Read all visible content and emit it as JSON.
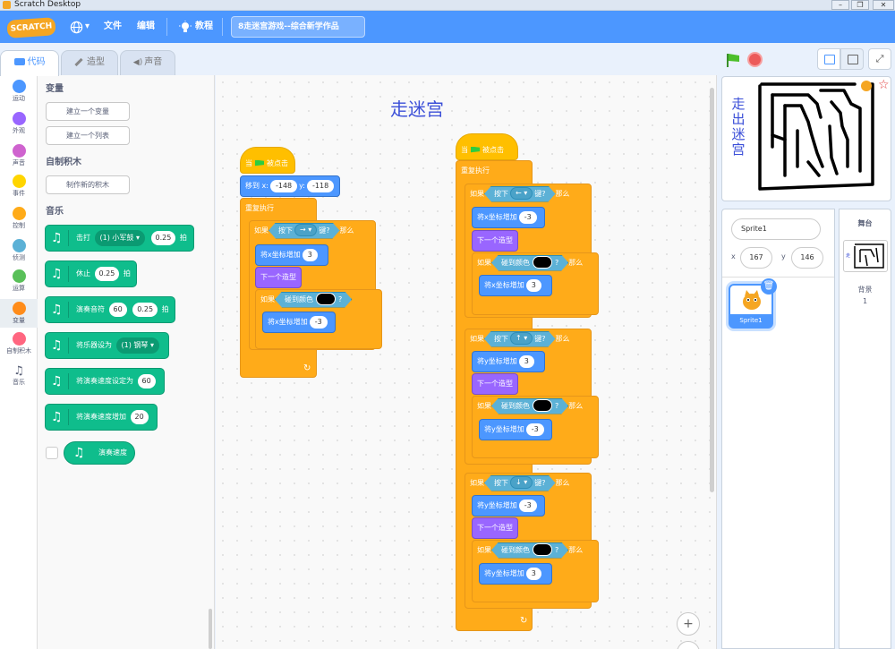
{
  "window": {
    "title": "Scratch Desktop",
    "buttons": [
      "–",
      "❐",
      "✕"
    ]
  },
  "menubar": {
    "logo": "SCRATCH",
    "globe_caret": "▾",
    "file": "文件",
    "edit": "编辑",
    "tutorials": "教程",
    "project_name": "8走迷宫游戏--综合新学作品"
  },
  "tabs": {
    "code": "代码",
    "costumes": "造型",
    "sounds": "声音"
  },
  "categories": [
    {
      "label": "运动",
      "color": "#4c97ff"
    },
    {
      "label": "外观",
      "color": "#9966ff"
    },
    {
      "label": "声音",
      "color": "#cf63cf"
    },
    {
      "label": "事件",
      "color": "#ffd500"
    },
    {
      "label": "控制",
      "color": "#ffab19"
    },
    {
      "label": "侦测",
      "color": "#5cb1d6"
    },
    {
      "label": "运算",
      "color": "#59c059"
    },
    {
      "label": "变量",
      "color": "#ff8c1a"
    },
    {
      "label": "自制积木",
      "color": "#ff6680"
    },
    {
      "label": "音乐",
      "color": "#0fbd8c"
    }
  ],
  "palette": {
    "variables_heading": "变量",
    "make_variable": "建立一个变量",
    "make_list": "建立一个列表",
    "myblocks_heading": "自制积木",
    "make_block": "制作新的积木",
    "music_heading": "音乐",
    "blocks": {
      "drum": {
        "pre": "击打",
        "menu": "(1) 小军鼓 ▾",
        "value": "0.25",
        "post": "拍"
      },
      "rest": {
        "pre": "休止",
        "value": "0.25",
        "post": "拍"
      },
      "note": {
        "pre": "演奏音符",
        "v1": "60",
        "v2": "0.25",
        "post": "拍"
      },
      "instrument": {
        "pre": "将乐器设为",
        "menu": "(1) 钢琴 ▾"
      },
      "set_tempo": {
        "pre": "将演奏速度设定为",
        "value": "60"
      },
      "change_tempo": {
        "pre": "将演奏速度增加",
        "value": "20"
      },
      "tempo_reporter": "演奏速度"
    }
  },
  "workspace": {
    "title": "走迷宫",
    "script1": {
      "hat": {
        "pre": "当",
        "post": "被点击"
      },
      "goto": {
        "pre": "移到 x:",
        "x": "-148",
        "ylabel": "y:",
        "y": "-118"
      },
      "forever": "重复执行",
      "if": "如果",
      "key_pre": "按下",
      "key_right": "→ ▾",
      "key_post": "键?",
      "then": "那么",
      "change_x_label": "将x坐标增加",
      "change_x_val": "3",
      "next_costume": "下一个造型",
      "touch_color": "碰到颜色",
      "q": "?",
      "change_x_back_val": "-3",
      "loop_arrow": "↻"
    },
    "script2": {
      "hat": {
        "pre": "当",
        "post": "被点击"
      },
      "forever": "重复执行",
      "if": "如果",
      "key_pre": "按下",
      "key_post": "键?",
      "then": "那么",
      "touch_color": "碰到颜色",
      "q": "?",
      "next_costume": "下一个造型",
      "change_x_label": "将x坐标增加",
      "change_y_label": "将y坐标增加",
      "key_left": "← ▾",
      "key_up": "↑ ▾",
      "key_down": "↓ ▾",
      "left_val": "-3",
      "left_back": "3",
      "up_val": "3",
      "up_back": "-3",
      "down_val": "-3",
      "down_back": "3",
      "loop_arrow": "↻"
    },
    "zoom_in": "+"
  },
  "stage": {
    "text": "走出迷宫"
  },
  "sprite_info": {
    "name": "Sprite1",
    "x_label": "x",
    "x": "167",
    "y_label": "y",
    "y": "146"
  },
  "sprites": [
    {
      "name": "Sprite1"
    }
  ],
  "stage_panel": {
    "title": "舞台",
    "backdrops_label": "背景",
    "backdrops_count": "1"
  }
}
